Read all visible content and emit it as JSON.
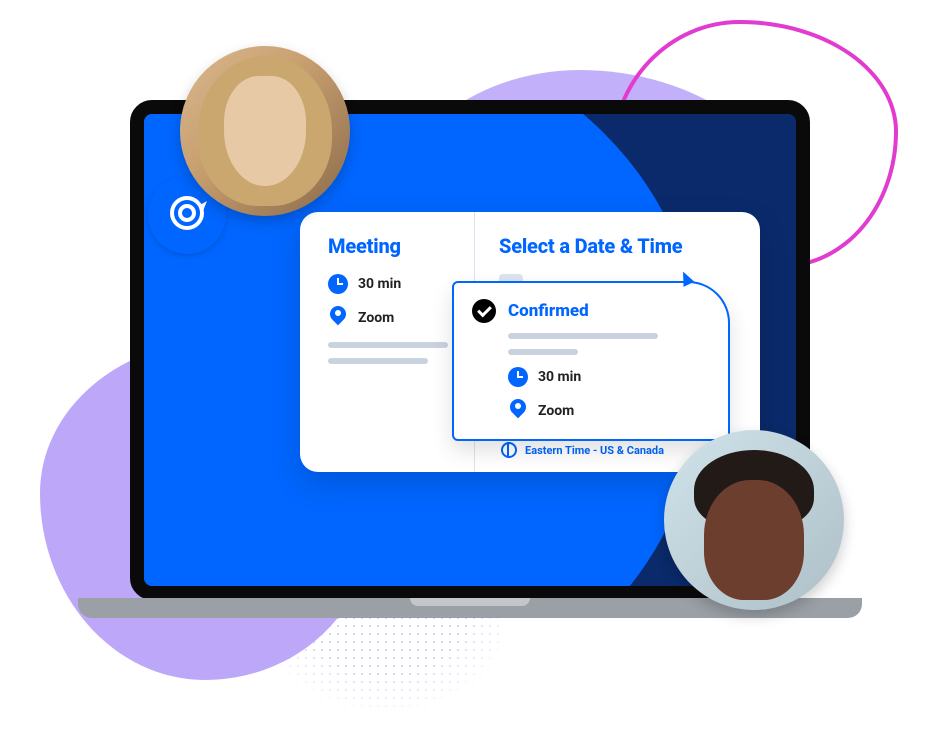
{
  "meeting": {
    "title": "Meeting",
    "duration": "30 min",
    "location": "Zoom"
  },
  "picker": {
    "title": "Select a Date & Time",
    "timezone": "Eastern Time - US & Canada"
  },
  "confirmation": {
    "status": "Confirmed",
    "duration": "30 min",
    "location": "Zoom"
  },
  "icons": {
    "brand": "calendly-logo-icon",
    "clock": "clock-icon",
    "pin": "location-pin-icon",
    "check": "checkmark-icon",
    "globe": "globe-icon",
    "cursor": "cursor-icon"
  }
}
